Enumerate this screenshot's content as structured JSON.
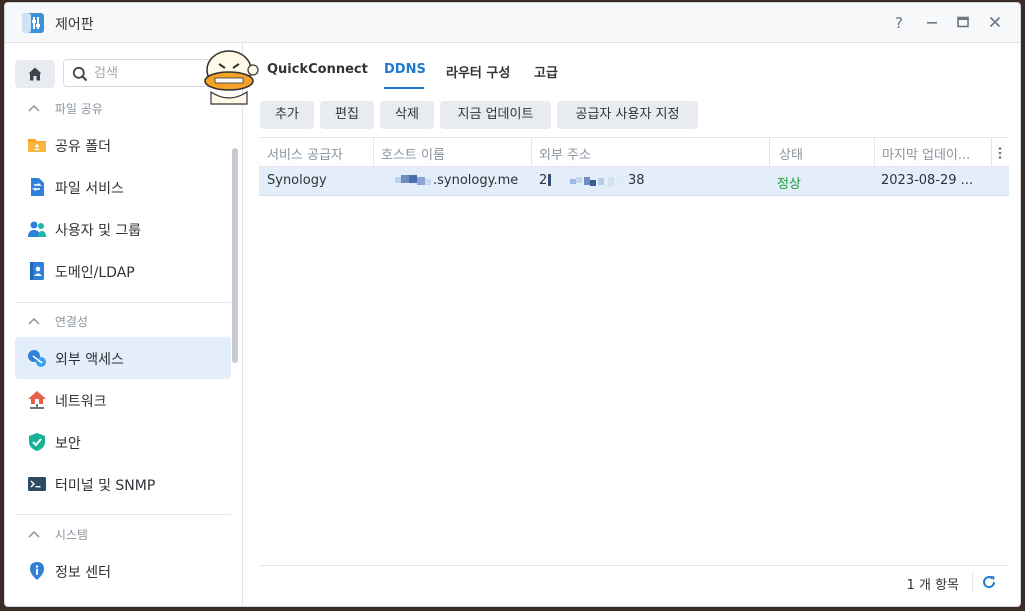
{
  "window": {
    "title": "제어판"
  },
  "titlebar": {
    "help": "?",
    "minimize": "—",
    "maximize": "▭",
    "close": "✕"
  },
  "sidebar": {
    "search_placeholder": "검색",
    "sections": [
      {
        "label": "파일 공유",
        "items": [
          {
            "label": "공유 폴더",
            "icon": "shared-folder-icon"
          },
          {
            "label": "파일 서비스",
            "icon": "file-services-icon"
          },
          {
            "label": "사용자 및 그룹",
            "icon": "user-group-icon"
          },
          {
            "label": "도메인/LDAP",
            "icon": "domain-ldap-icon"
          }
        ]
      },
      {
        "label": "연결성",
        "items": [
          {
            "label": "외부 액세스",
            "icon": "external-access-icon",
            "active": true
          },
          {
            "label": "네트워크",
            "icon": "network-icon"
          },
          {
            "label": "보안",
            "icon": "security-shield-icon"
          },
          {
            "label": "터미널 및 SNMP",
            "icon": "terminal-icon"
          }
        ]
      },
      {
        "label": "시스템",
        "items": [
          {
            "label": "정보 센터",
            "icon": "info-center-icon"
          }
        ]
      }
    ]
  },
  "tabs": [
    {
      "label": "QuickConnect",
      "active": false
    },
    {
      "label": "DDNS",
      "active": true
    },
    {
      "label": "라우터 구성",
      "active": false
    },
    {
      "label": "고급",
      "active": false
    }
  ],
  "toolbar": {
    "add": "추가",
    "edit": "편집",
    "delete": "삭제",
    "update_now": "지금 업데이트",
    "customize_provider": "공급자 사용자 지정"
  },
  "grid": {
    "columns": [
      "서비스 공급자",
      "호스트 이름",
      "외부 주소",
      "상태",
      "마지막 업데이..."
    ],
    "rows": [
      {
        "provider": "Synology",
        "hostname": ".synology.me",
        "address_start": "2",
        "address_end": "38",
        "status": "정상",
        "last_update": "2023-08-29 ..."
      }
    ]
  },
  "footer": {
    "count": "1 개 항목"
  },
  "colors": {
    "accent": "#1f7ad3",
    "status_ok": "#1d9b3a",
    "selected_row": "#e3eefa"
  }
}
